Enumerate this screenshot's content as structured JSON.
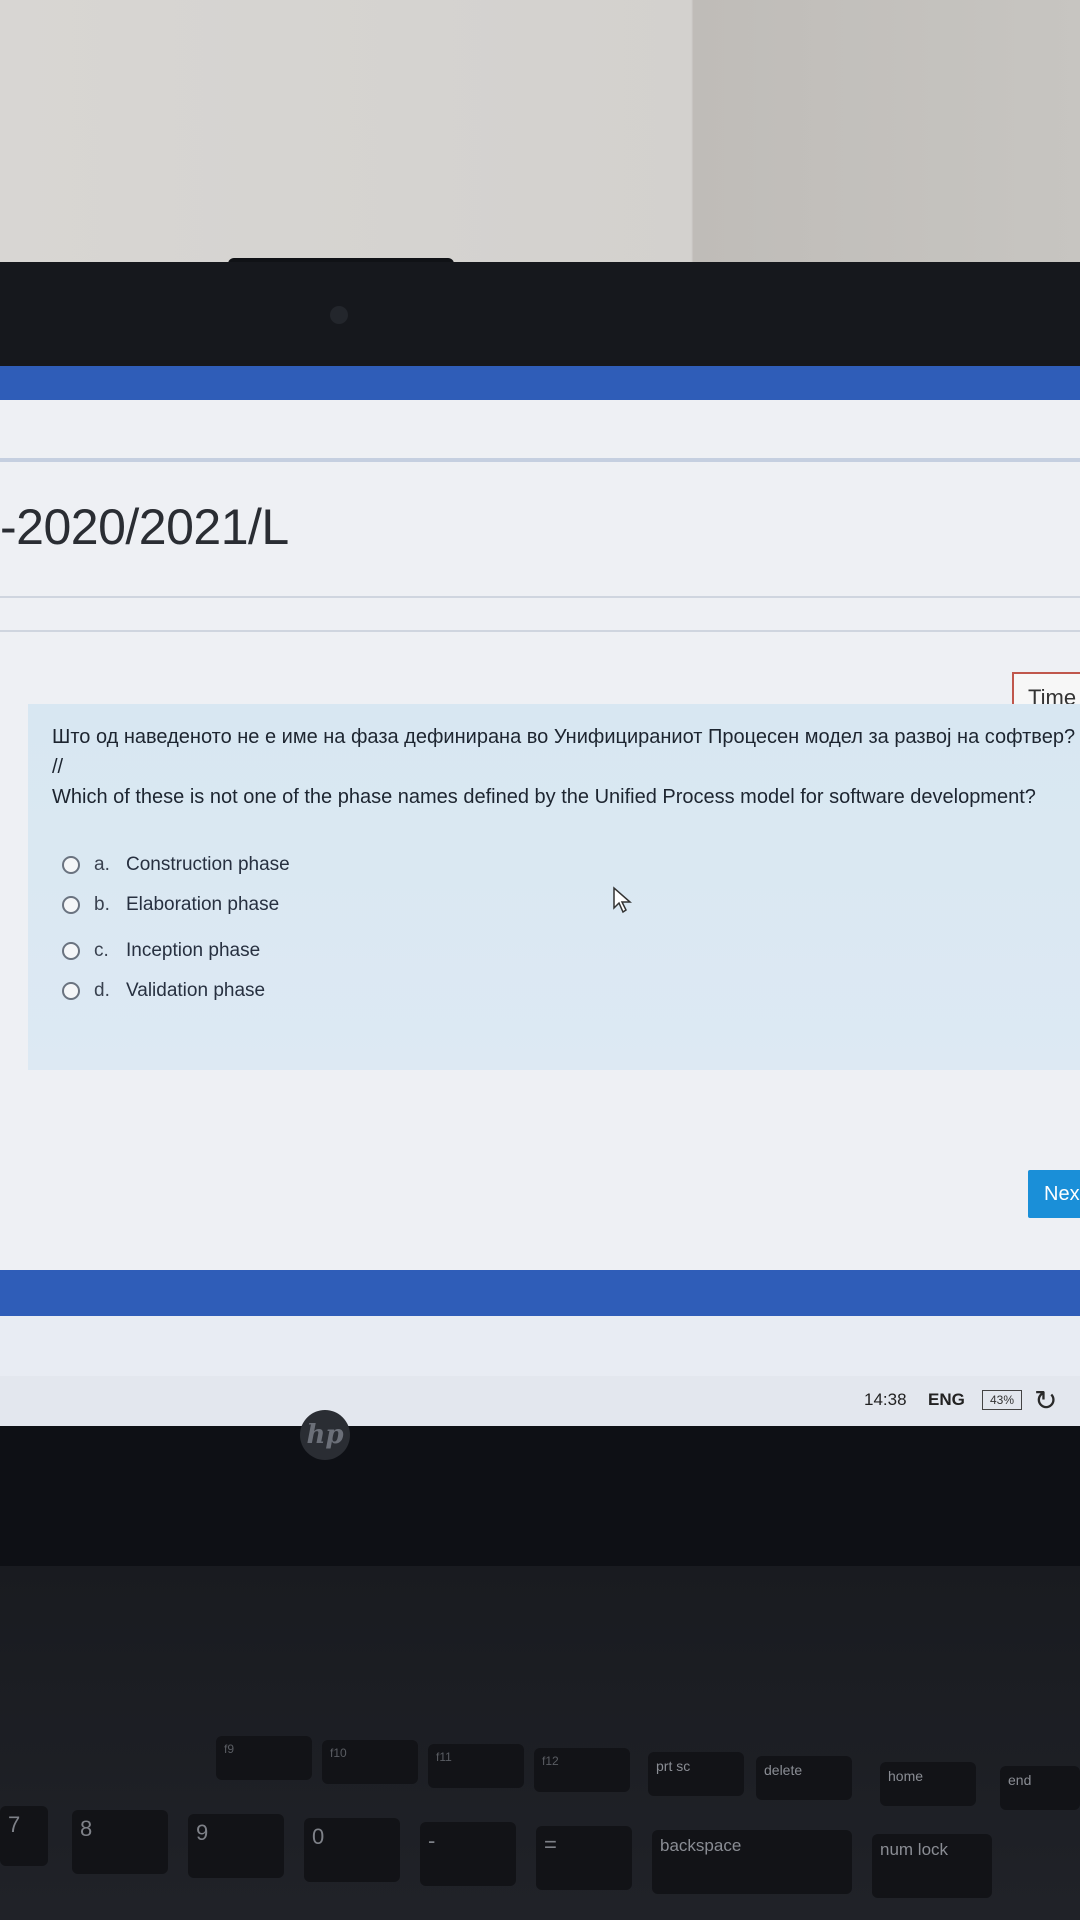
{
  "page": {
    "course_title": "-2020/2021/L",
    "timer_label": "Time",
    "next_label": "Nex"
  },
  "question": {
    "text_mk": "Што од наведеното не е име на фаза дефинирана во Унифицираниот Процесен модел за развој на софтвер?",
    "separator": "//",
    "text_en": "Which of these is not one of the phase names defined by the Unified Process model for software development?",
    "options": [
      {
        "letter": "a.",
        "label": "Construction phase"
      },
      {
        "letter": "b.",
        "label": "Elaboration phase"
      },
      {
        "letter": "c.",
        "label": "Inception phase"
      },
      {
        "letter": "d.",
        "label": "Validation phase"
      }
    ]
  },
  "taskbar": {
    "time": "14:38",
    "language": "ENG",
    "battery": "43%"
  },
  "device": {
    "brand": "hp"
  },
  "keyboard": {
    "function_row": [
      "f9",
      "f10",
      "f11",
      "f12",
      "prt sc",
      "delete",
      "home",
      "end"
    ],
    "number_row": [
      "7",
      "8",
      "9",
      "0",
      "-",
      "=",
      "backspace",
      "num lock"
    ]
  },
  "colors": {
    "accent_blue": "#2f5db8",
    "next_button": "#1a8fd8",
    "timer_border": "#c0574c",
    "question_panel": "#d8e7f2"
  }
}
